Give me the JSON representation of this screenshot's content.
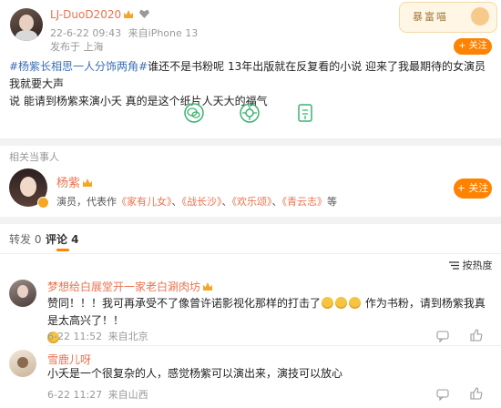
{
  "post": {
    "username": "LJ-DuoD2020",
    "meta_time": "22-6-22 09:43",
    "meta_source": "来自iPhone 13",
    "location": "发布于 上海",
    "hashtag": "#杨紫长相思一人分饰两角#",
    "body_line1": "谁还不是书粉呢 13年出版就在反复看的小说 迎来了我最期待的女演员 我就要大声",
    "body_line2": "说 能请到杨紫来演小夭 真的是这个纸片人天大的福气",
    "badge_text": "暴富喵"
  },
  "related": {
    "heading": "相关当事人",
    "name": "杨紫",
    "desc_prefix": "演员，代表作",
    "works": [
      "《家有儿女》",
      "《战长沙》",
      "《欢乐颂》",
      "《青云志》"
    ],
    "desc_suffix": "等",
    "follow_label": "+ 关注"
  },
  "header_follow_label": "+ 关注",
  "tabs": {
    "repost": "转发 0",
    "comment": "评论 4"
  },
  "sort_label": "按热度",
  "comments": [
    {
      "user": "梦想给白展堂开一家老白涮肉坊",
      "text_a": "赞同！！！我可再承受不了像曾许诺影视化那样的打击了",
      "text_b": "作为书粉，请到杨紫我真是太高兴了！！",
      "time": "6-22 11:52",
      "source": "来自北京"
    },
    {
      "user": "雪鹿儿呀",
      "text": "小夭是一个很复杂的人，感觉杨紫可以演出来，演技可以放心",
      "time": "6-22 11:27",
      "source": "来自山西"
    }
  ],
  "icons": [
    "avatar",
    "wechat-icon",
    "moments-icon",
    "bookmark-icon",
    "sort-icon",
    "like-icon",
    "reply-icon"
  ],
  "colors": {
    "accent": "#ff8200",
    "link": "#eb7350"
  }
}
